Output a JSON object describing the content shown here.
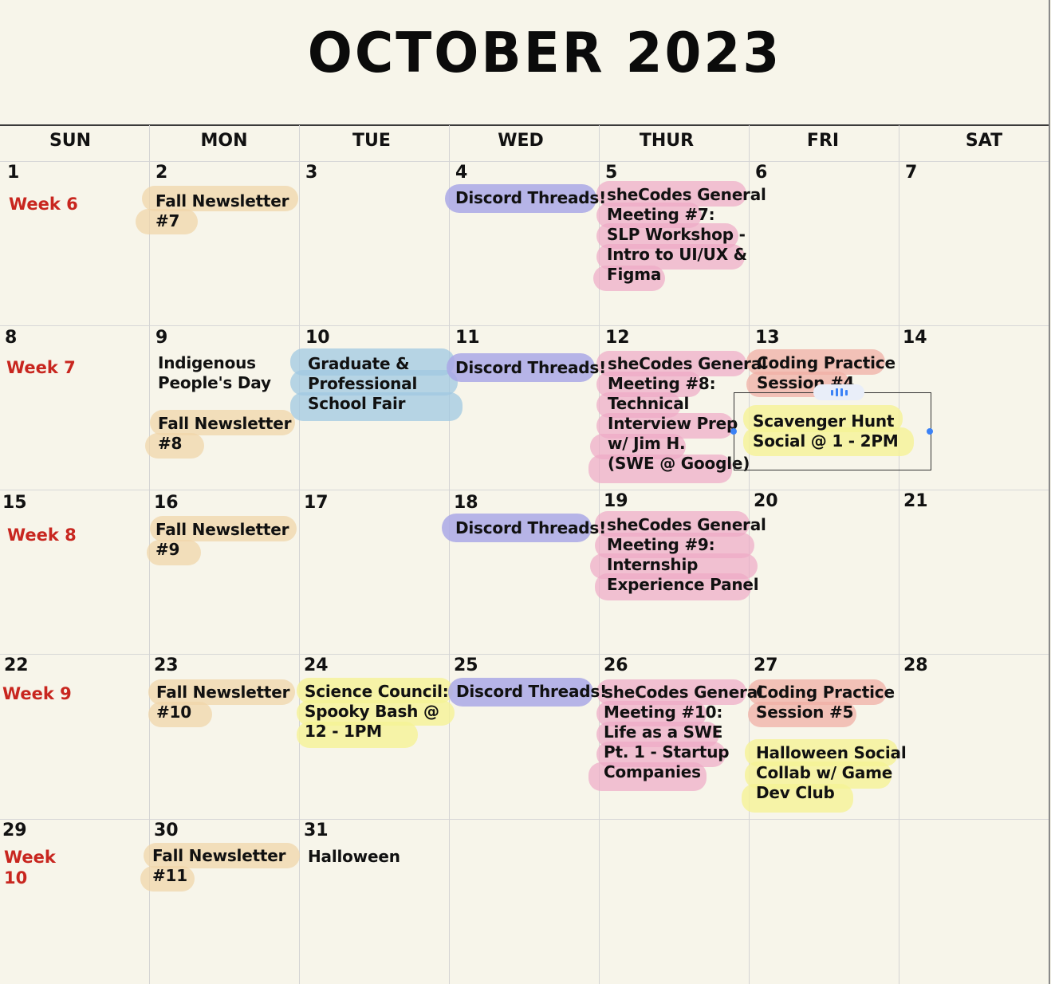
{
  "calendar": {
    "title": "OCTOBER 2023",
    "days_of_week": [
      "SUN",
      "MON",
      "TUE",
      "WED",
      "THUR",
      "FRI",
      "SAT"
    ],
    "day_numbers": [
      "1",
      "2",
      "3",
      "4",
      "5",
      "6",
      "7",
      "8",
      "9",
      "10",
      "11",
      "12",
      "13",
      "14",
      "15",
      "16",
      "17",
      "18",
      "19",
      "20",
      "21",
      "22",
      "23",
      "24",
      "25",
      "26",
      "27",
      "28",
      "29",
      "30",
      "31"
    ],
    "weeks": [
      "Week 6",
      "Week 7",
      "Week 8",
      "Week 9",
      "Week 10"
    ],
    "events": {
      "d2": "Fall Newsletter\n#7",
      "d4": "Discord Threads!",
      "d5": "sheCodes General\nMeeting #7:\nSLP Workshop -\nIntro to UI/UX &\nFigma",
      "d9a": "Indigenous\nPeople's Day",
      "d9b": "Fall Newsletter\n#8",
      "d10": "Graduate &\nProfessional\nSchool Fair",
      "d11": "Discord Threads!",
      "d12": "sheCodes General\nMeeting #8:\nTechnical\nInterview Prep\nw/ Jim H.\n(SWE @ Google)",
      "d13a": "Coding Practice\nSession #4",
      "d13b": "Scavenger Hunt\nSocial @ 1 - 2PM",
      "d16": "Fall Newsletter\n#9",
      "d18": "Discord Threads!",
      "d19": "sheCodes General\nMeeting #9:\nInternship\nExperience Panel",
      "d23": "Fall Newsletter\n#10",
      "d24": "Science Council:\nSpooky Bash @\n12 - 1PM",
      "d25": "Discord Threads!",
      "d26": "sheCodes General\nMeeting #10:\nLife as a SWE\nPt. 1 - Startup\nCompanies",
      "d27a": "Coding Practice\nSession #5",
      "d27b": "Halloween Social\nCollab w/ Game\nDev Club",
      "d30": "Fall Newsletter\n#11",
      "d31": "Halloween"
    },
    "colors": {
      "background": "#f7f5ea",
      "week_label": "#c8261f",
      "newsletter": "#f0d6aa",
      "general_meeting": "#eeaac6",
      "discord": "#aaa8e6",
      "fair": "#a0c8e2",
      "social": "#f5f396",
      "coding_practice": "#f0afa5",
      "selection_handle": "#3b82f6"
    }
  }
}
